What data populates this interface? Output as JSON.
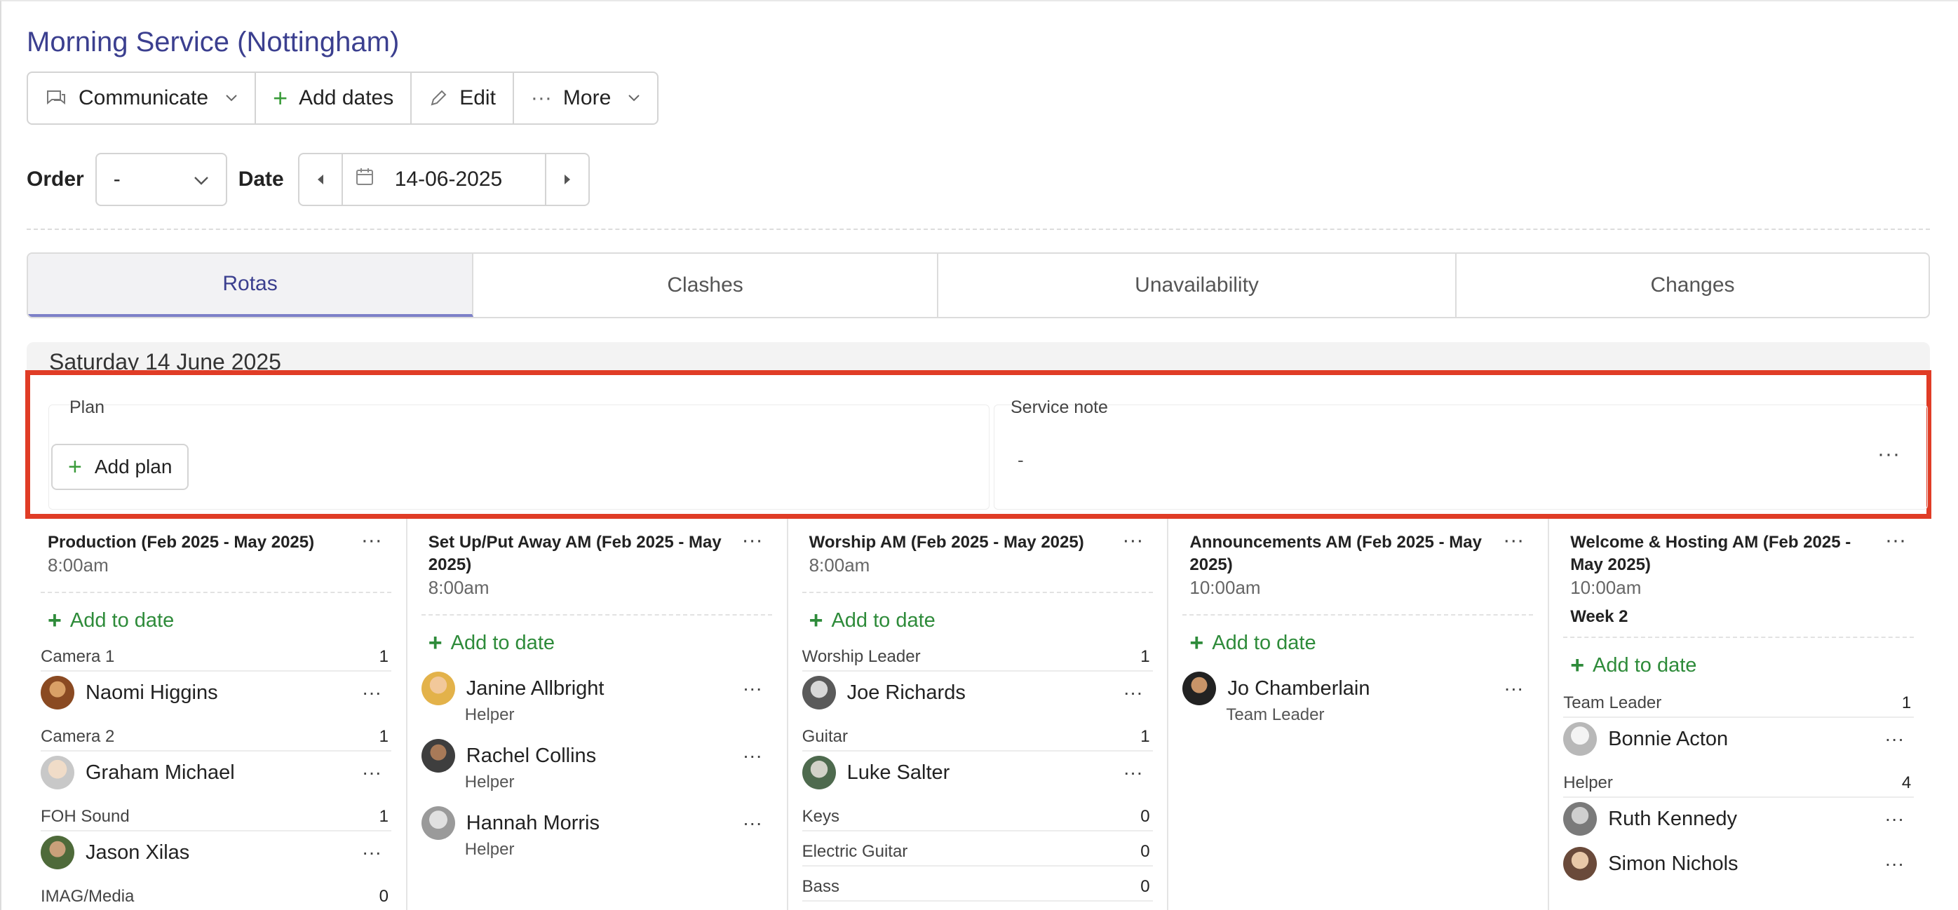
{
  "page_title": "Morning Service (Nottingham)",
  "toolbar": {
    "communicate": "Communicate",
    "add_dates": "Add dates",
    "edit": "Edit",
    "more": "More"
  },
  "filters": {
    "order_label": "Order",
    "order_value": "-",
    "date_label": "Date",
    "date_value": "14-06-2025"
  },
  "tabs": [
    "Rotas",
    "Clashes",
    "Unavailability",
    "Changes"
  ],
  "active_tab": "Rotas",
  "day_label": "Saturday 14 June 2025",
  "plan": {
    "label": "Plan",
    "add_plan": "Add plan"
  },
  "service_note": {
    "label": "Service note",
    "value": "-"
  },
  "colors": {
    "title": "#3b3f8f",
    "accent_green": "#2e8b3a",
    "highlight": "#e03c26"
  },
  "columns": [
    {
      "title": "Production (Feb 2025 - May 2025)",
      "time": "8:00am",
      "add_label": "Add to date",
      "roles": [
        {
          "name": "Camera 1",
          "count": "1",
          "people": [
            {
              "name": "Naomi Higgins",
              "sub": ""
            }
          ]
        },
        {
          "name": "Camera 2",
          "count": "1",
          "people": [
            {
              "name": "Graham Michael",
              "sub": ""
            }
          ]
        },
        {
          "name": "FOH Sound",
          "count": "1",
          "people": [
            {
              "name": "Jason Xilas",
              "sub": ""
            }
          ]
        },
        {
          "name": "IMAG/Media",
          "count": "0",
          "people": []
        }
      ]
    },
    {
      "title": "Set Up/Put Away AM (Feb 2025 - May 2025)",
      "time": "8:00am",
      "add_label": "Add to date",
      "people": [
        {
          "name": "Janine Allbright",
          "sub": "Helper"
        },
        {
          "name": "Rachel Collins",
          "sub": "Helper"
        },
        {
          "name": "Hannah Morris",
          "sub": "Helper"
        }
      ]
    },
    {
      "title": "Worship AM (Feb 2025 - May 2025)",
      "time": "8:00am",
      "add_label": "Add to date",
      "roles": [
        {
          "name": "Worship Leader",
          "count": "1",
          "people": [
            {
              "name": "Joe Richards"
            }
          ]
        },
        {
          "name": "Guitar",
          "count": "1",
          "people": [
            {
              "name": "Luke Salter"
            }
          ]
        },
        {
          "name": "Keys",
          "count": "0",
          "people": []
        },
        {
          "name": "Electric Guitar",
          "count": "0",
          "people": []
        },
        {
          "name": "Bass",
          "count": "0",
          "people": []
        }
      ]
    },
    {
      "title": "Announcements AM (Feb 2025 - May 2025)",
      "time": "10:00am",
      "add_label": "Add to date",
      "people": [
        {
          "name": "Jo Chamberlain",
          "sub": "Team Leader"
        }
      ]
    },
    {
      "title": "Welcome & Hosting AM (Feb 2025 - May 2025)",
      "time": "10:00am",
      "week": "Week 2",
      "add_label": "Add to date",
      "roles": [
        {
          "name": "Team Leader",
          "count": "1",
          "people": [
            {
              "name": "Bonnie Acton"
            }
          ]
        },
        {
          "name": "Helper",
          "count": "4",
          "people": [
            {
              "name": "Ruth Kennedy"
            },
            {
              "name": "Simon Nichols"
            }
          ]
        }
      ]
    }
  ]
}
